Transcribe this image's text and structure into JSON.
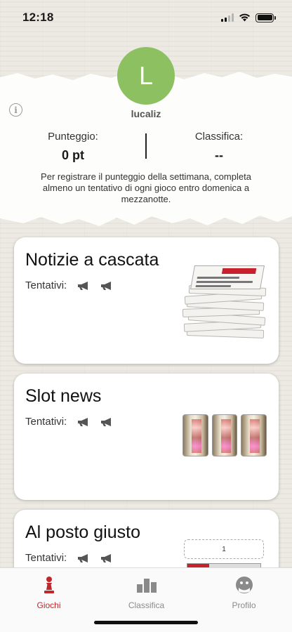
{
  "status": {
    "time": "12:18"
  },
  "profile": {
    "initial": "L",
    "username": "lucaliz",
    "avatar_color": "#8dc060"
  },
  "stats": {
    "score_label": "Punteggio:",
    "score_value": "0 pt",
    "rank_label": "Classifica:",
    "rank_value": "--"
  },
  "rules_text": "Per registrare il punteggio della settimana, completa almeno un tentativo di ogni gioco entro domenica a mezzanotte.",
  "games": [
    {
      "title": "Notizie a cascata",
      "attempts_label": "Tentativi:",
      "art": "newspaper-stack"
    },
    {
      "title": "Slot news",
      "attempts_label": "Tentativi:",
      "art": "slot-reels"
    },
    {
      "title": "Al posto giusto",
      "attempts_label": "Tentativi:",
      "art": "drop-slot",
      "slot_number": "1"
    }
  ],
  "tabs": [
    {
      "label": "Giochi",
      "icon": "pawn-icon",
      "active": true
    },
    {
      "label": "Classifica",
      "icon": "bar-chart-icon",
      "active": false
    },
    {
      "label": "Profilo",
      "icon": "profile-face-icon",
      "active": false
    }
  ],
  "colors": {
    "accent": "#c0272d",
    "inactive": "#8a8a8a"
  }
}
